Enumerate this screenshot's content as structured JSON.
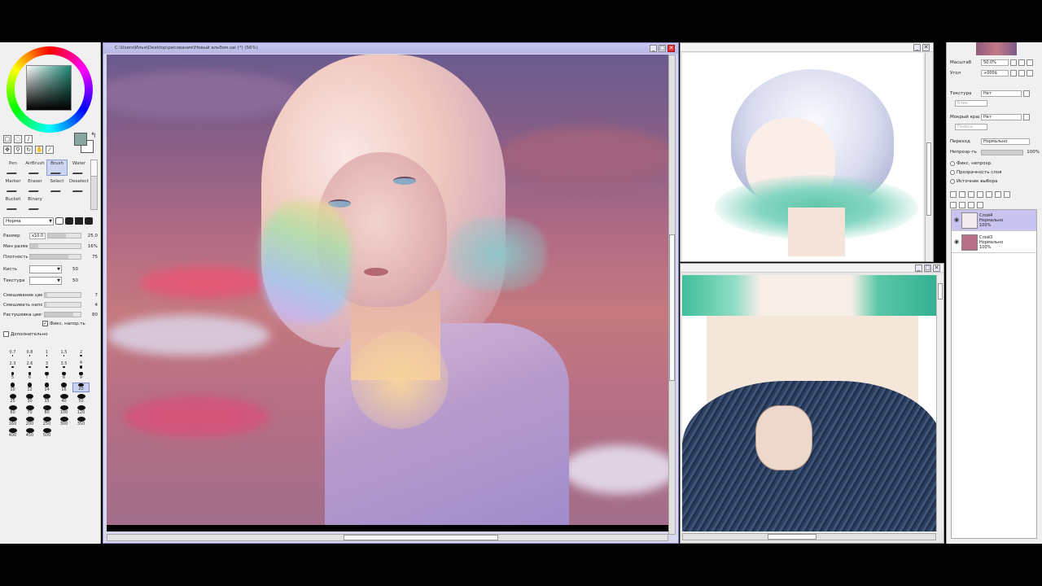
{
  "left_panel": {
    "tools": [
      {
        "name": "Pen",
        "active": false
      },
      {
        "name": "AirBrush",
        "active": false
      },
      {
        "name": "Brush",
        "active": true
      },
      {
        "name": "Water",
        "active": false
      },
      {
        "name": "Marker",
        "active": false
      },
      {
        "name": "Eraser",
        "active": false
      },
      {
        "name": "Select",
        "active": false
      },
      {
        "name": "Deselect",
        "active": false
      },
      {
        "name": "Bucket",
        "active": false
      },
      {
        "name": "Binary",
        "active": false
      }
    ],
    "blend_mode": "Норма",
    "params": [
      {
        "label": "Размер",
        "value": "25.0",
        "mult": "x10.0"
      },
      {
        "label": "Мин размер",
        "value": "16%"
      },
      {
        "label": "Плотность",
        "value": "75"
      },
      {
        "label": "Кисть",
        "value": "50"
      },
      {
        "label": "Текстура",
        "value": "50"
      }
    ],
    "mix_params": [
      {
        "label": "Смешивание цвет",
        "value": "7"
      },
      {
        "label": "Смешивать напор",
        "value": "4"
      },
      {
        "label": "Растушевка цвет",
        "value": "80"
      }
    ],
    "keep_opacity": "Фикс. напор.ть",
    "extra_label": "Дополнительно",
    "brush_sizes": [
      "0.7",
      "0.8",
      "1",
      "1.5",
      "2",
      "2.3",
      "2.6",
      "3",
      "3.5",
      "4",
      "5",
      "6",
      "7",
      "8",
      "9",
      "10",
      "12",
      "14",
      "16",
      "20",
      "25",
      "30",
      "35",
      "40",
      "50",
      "60",
      "70",
      "80",
      "100",
      "120",
      "160",
      "200",
      "250",
      "300",
      "350",
      "400",
      "450",
      "500"
    ]
  },
  "canvas": {
    "title": "C:\\Users\\Илья\\Desktop\\рисование\\Новый альбом.sai (*) (56%)",
    "minimize": "_",
    "maximize": "□",
    "close": "✕"
  },
  "right_panel": {
    "zoom_label": "Масштаб",
    "zoom_value": "50.0%",
    "angle_label": "Угол",
    "angle_value": "+000$",
    "texture_label": "Текстура",
    "texture_value": "Нет",
    "texture_sub": "Блик",
    "effect_label": "Мокрый край",
    "effect_value": "Нет",
    "effect_sub": "Полоса",
    "mode_label": "Переход",
    "mode_value": "Нормально",
    "opacity_label": "Непрозр-ть",
    "opacity_value": "100%",
    "options": [
      "Фикс. непрозр.",
      "Прозрачность слоя",
      "Источник выбора"
    ],
    "layers": [
      {
        "name": "Слой4",
        "mode": "Нормально",
        "opacity": "100%",
        "active": true,
        "thumb": "#f2e9ee"
      },
      {
        "name": "Слой3",
        "mode": "Нормально",
        "opacity": "100%",
        "active": false,
        "thumb": "#b66f86"
      }
    ]
  },
  "colors": {
    "foreground": "#8aa6a0",
    "background": "#ffffff",
    "accent_title": "#c8c8f0"
  }
}
